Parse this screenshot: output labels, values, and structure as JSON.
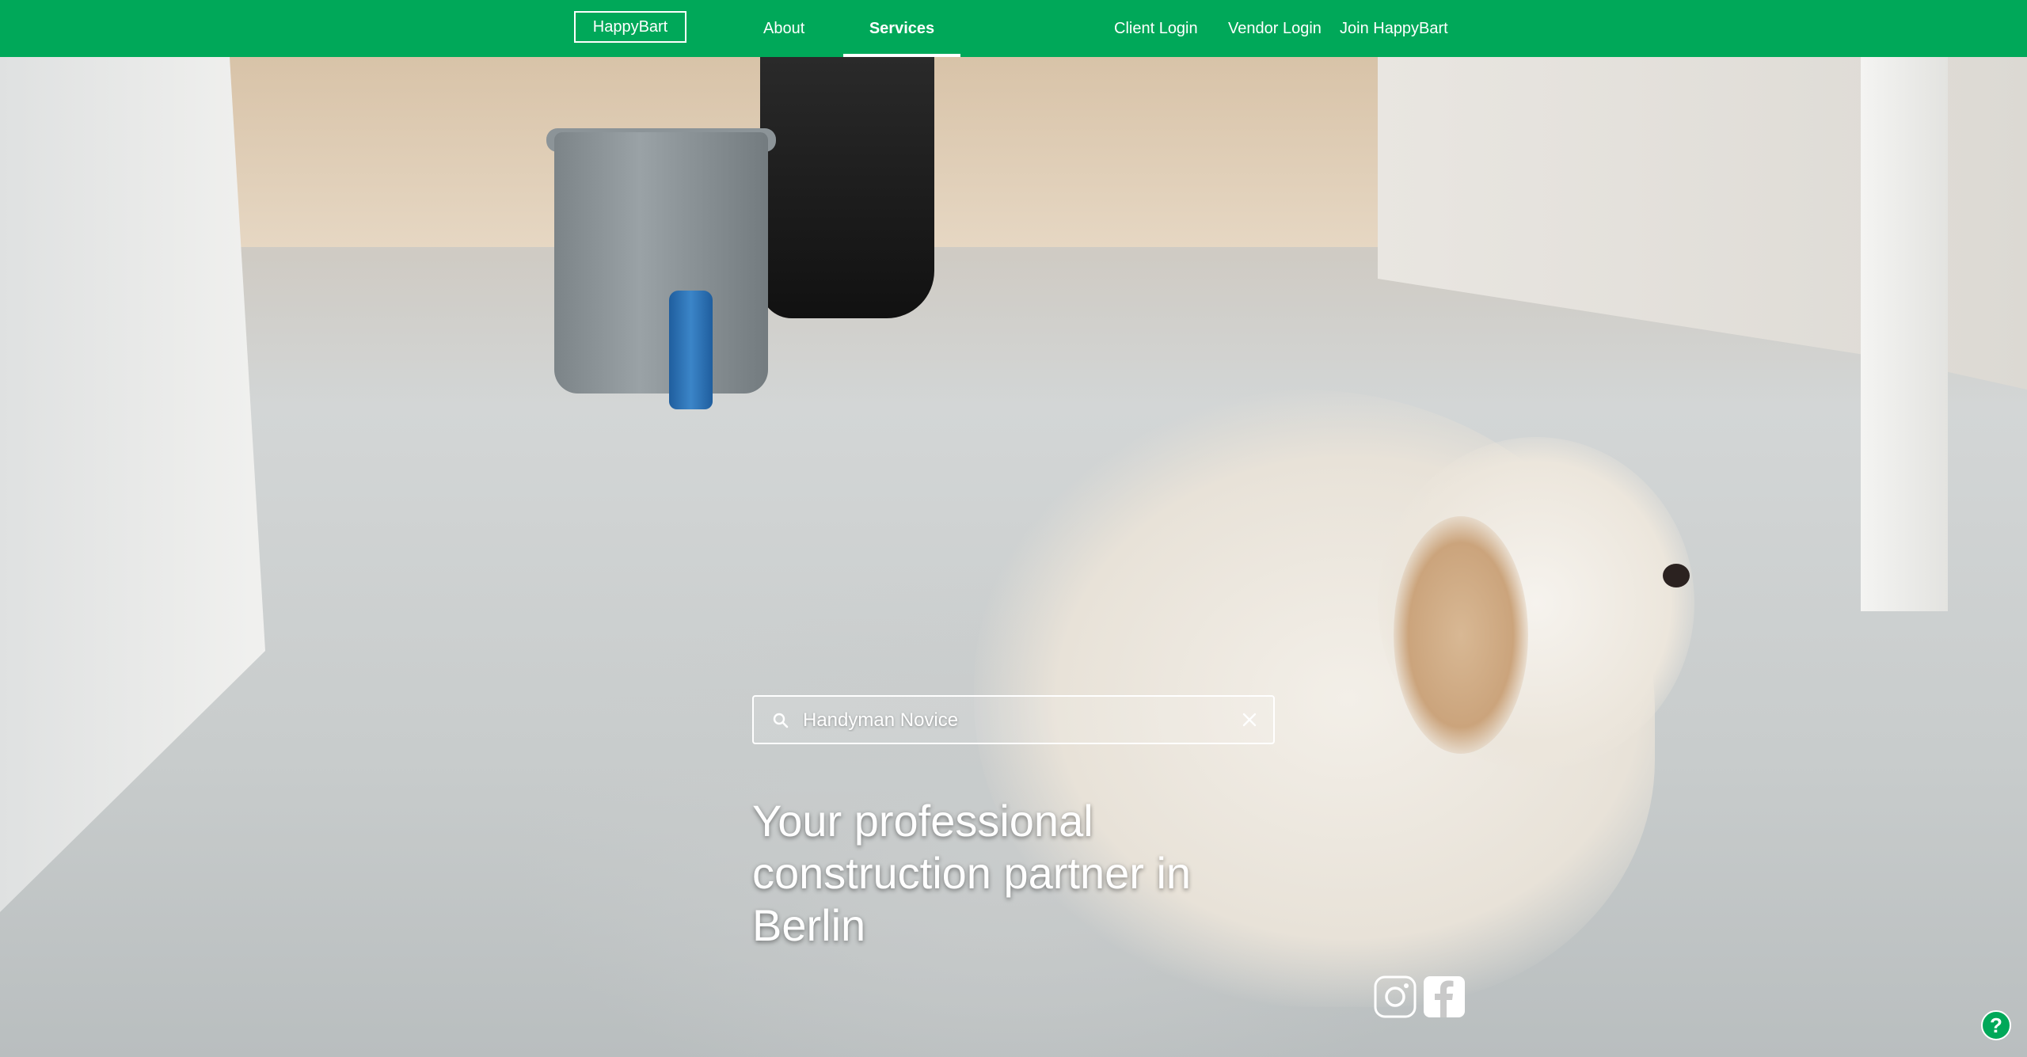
{
  "navbar": {
    "logo": "HappyBart",
    "links": {
      "about": "About",
      "services": "Services",
      "client_login": "Client Login",
      "vendor_login": "Vendor Login",
      "join": "Join HappyBart"
    },
    "active_link": "Services",
    "background_color": "#00a859"
  },
  "search": {
    "value": "Handyman Novice",
    "icon": "search-icon",
    "clear_icon": "close-icon"
  },
  "hero": {
    "tagline": "Your professional construction partner in Berlin",
    "background": "photo of renovation site with white dog"
  },
  "social": {
    "instagram_icon": "instagram-icon",
    "facebook_icon": "facebook-icon"
  },
  "help": {
    "label": "?",
    "icon": "help-icon"
  }
}
